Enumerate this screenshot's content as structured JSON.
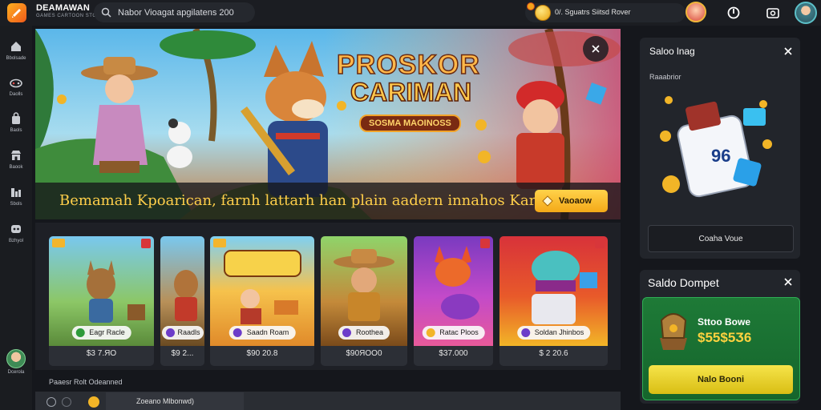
{
  "topbar": {
    "brand": "DEAMAWAN",
    "brand_sub": "GAMES CARTOON STORE",
    "search_value": "Nabor Vioagat apgilatens 200",
    "coin_text": "0/. Sguatrs Siitsd Rover"
  },
  "sidebar": {
    "items": [
      {
        "label": "Bbolsade",
        "icon": "home-icon"
      },
      {
        "label": "Daolls",
        "icon": "controller-icon"
      },
      {
        "label": "Baols",
        "icon": "bag-icon"
      },
      {
        "label": "Baook",
        "icon": "store-icon"
      },
      {
        "label": "Sbols",
        "icon": "chart-icon"
      },
      {
        "label": "Bzhyol",
        "icon": "gamepad-icon"
      }
    ],
    "user_label": "Dcerola"
  },
  "hero": {
    "title_line1": "PROSKOR",
    "title_line2": "CARIMAN",
    "title_line3": "SOSMA MAOINOSS",
    "banner_text": "Bemamah Kpoarican, farnh lattarh han plain aadern innahos Karin.",
    "cta_label": "Vaoaow"
  },
  "games": [
    {
      "title": "Eagr Racle",
      "price": "$3 7.ЯO"
    },
    {
      "title": "Raadls",
      "price": "$9 2..."
    },
    {
      "title": "Saadn Roam",
      "price": "$90 20.8"
    },
    {
      "title": "Roothea",
      "price": "$90ЯOO0"
    },
    {
      "title": "Ratac Ploos",
      "price": "$37.000"
    },
    {
      "title": "Soldan Jhinbos",
      "price": "$ 2 20.6"
    }
  ],
  "section_label": "Paaesr Rolt Odeanned",
  "bottom_input": "Zoeano Mlbonwd)",
  "shop_panel": {
    "title": "Saloo lnag",
    "subtitle": "Raaabrior",
    "dice_number": "96",
    "button_label": "Coaha Voue"
  },
  "wallet_panel": {
    "title": "Saldo Dompet",
    "label": "Sttoo Bowe",
    "amount": "$55$5Ӡ6",
    "button_label": "Nalo Booni"
  },
  "colors": {
    "background": "#15171c",
    "accent_yellow": "#ffcf4a",
    "wallet_green": "#1e7a37"
  }
}
